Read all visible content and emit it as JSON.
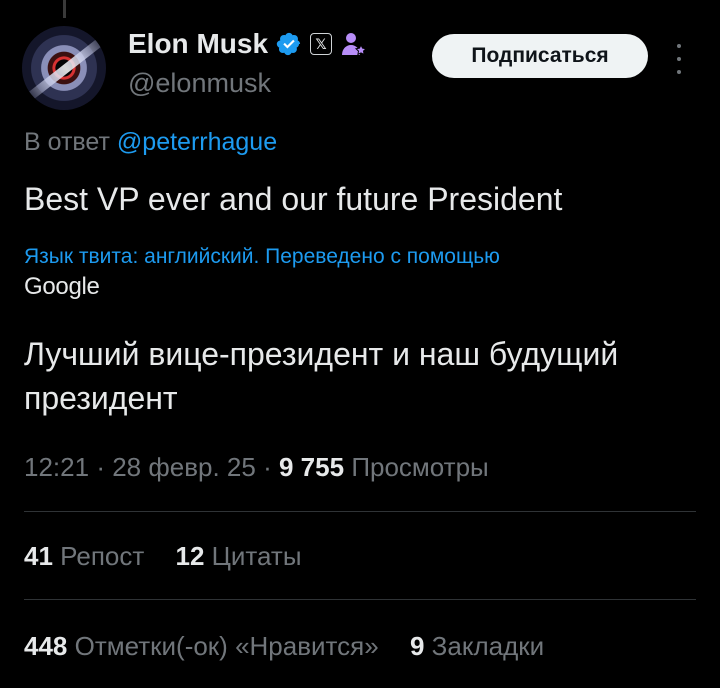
{
  "author": {
    "display_name": "Elon Musk",
    "handle": "@elonmusk",
    "x_badge": "𝕏"
  },
  "follow_label": "Подписаться",
  "reply": {
    "prefix": "В ответ",
    "mention": "@peterrhague"
  },
  "tweet_text": "Best VP ever and our future President",
  "translation": {
    "note": "Язык твита: английский. Переведено с помощью",
    "provider": "Google",
    "text": "Лучший вице-президент и наш будущий президент"
  },
  "meta": {
    "time": "12:21",
    "date": "28 февр. 25",
    "views_count": "9 755",
    "views_label": "Просмотры"
  },
  "stats": {
    "reposts_count": "41",
    "reposts_label": "Репост",
    "quotes_count": "12",
    "quotes_label": "Цитаты",
    "likes_count": "448",
    "likes_label": "Отметки(-ок) «Нравится»",
    "bookmarks_count": "9",
    "bookmarks_label": "Закладки"
  },
  "colors": {
    "background": "#000000",
    "link": "#1d9bf0",
    "muted": "#71767b",
    "verified": "#1d9bf0",
    "affiliate": "#b78df7"
  },
  "icons": [
    "verified-icon",
    "x-badge-icon",
    "affiliate-icon",
    "more-icon"
  ]
}
